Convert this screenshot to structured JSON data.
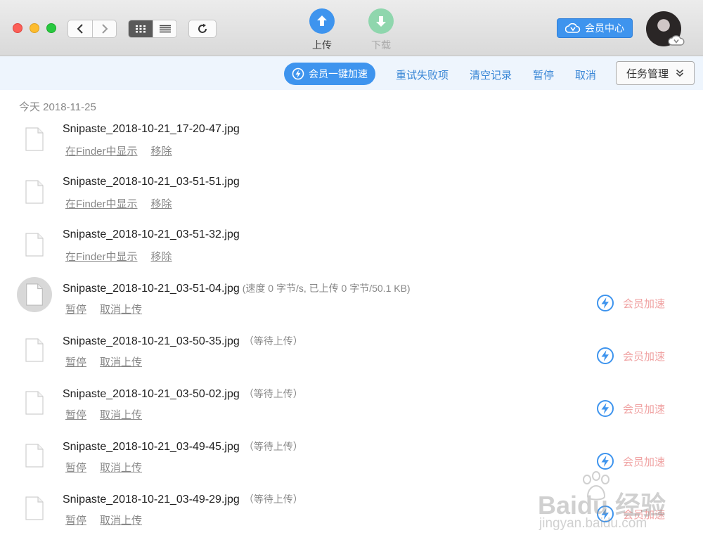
{
  "toolbar": {
    "upload_label": "上传",
    "download_label": "下载",
    "vip_center_label": "会员中心",
    "icons": {
      "back": "chevron-left-icon",
      "forward": "chevron-right-icon",
      "grid_view": "grid-view-icon",
      "list_view": "list-view-icon",
      "refresh": "refresh-icon",
      "upload": "arrow-up-icon",
      "download": "arrow-down-icon",
      "vip": "cloud-vip-icon"
    }
  },
  "actionbar": {
    "boost_all_label": "会员一键加速",
    "retry_failed_label": "重试失败项",
    "clear_records_label": "清空记录",
    "pause_label": "暂停",
    "cancel_label": "取消",
    "task_manager_label": "任务管理"
  },
  "list": {
    "date_header": "今天 2018-11-25",
    "finished": [
      {
        "name": "Snipaste_2018-10-21_17-20-47.jpg",
        "show_label": "在Finder中显示",
        "remove_label": "移除"
      },
      {
        "name": "Snipaste_2018-10-21_03-51-51.jpg",
        "show_label": "在Finder中显示",
        "remove_label": "移除"
      },
      {
        "name": "Snipaste_2018-10-21_03-51-32.jpg",
        "show_label": "在Finder中显示",
        "remove_label": "移除"
      }
    ],
    "pending": [
      {
        "name": "Snipaste_2018-10-21_03-51-04.jpg",
        "status": "(速度 0 字节/s, 已上传 0 字节/50.1 KB)",
        "pause_label": "暂停",
        "cancel_label": "取消上传",
        "boost_label": "会员加速"
      },
      {
        "name": "Snipaste_2018-10-21_03-50-35.jpg",
        "status": "（等待上传）",
        "pause_label": "暂停",
        "cancel_label": "取消上传",
        "boost_label": "会员加速"
      },
      {
        "name": "Snipaste_2018-10-21_03-50-02.jpg",
        "status": "（等待上传）",
        "pause_label": "暂停",
        "cancel_label": "取消上传",
        "boost_label": "会员加速"
      },
      {
        "name": "Snipaste_2018-10-21_03-49-45.jpg",
        "status": "（等待上传）",
        "pause_label": "暂停",
        "cancel_label": "取消上传",
        "boost_label": "会员加速"
      },
      {
        "name": "Snipaste_2018-10-21_03-49-29.jpg",
        "status": "（等待上传）",
        "pause_label": "暂停",
        "cancel_label": "取消上传",
        "boost_label": "会员加速"
      }
    ]
  },
  "watermark": {
    "brand": "Baidu 经验",
    "url": "jingyan.baidu.com"
  },
  "colors": {
    "accent": "#3e94ee",
    "link": "#3a87d6",
    "boost_text": "#f0a3a3",
    "download_icon": "#8fd6ad"
  }
}
